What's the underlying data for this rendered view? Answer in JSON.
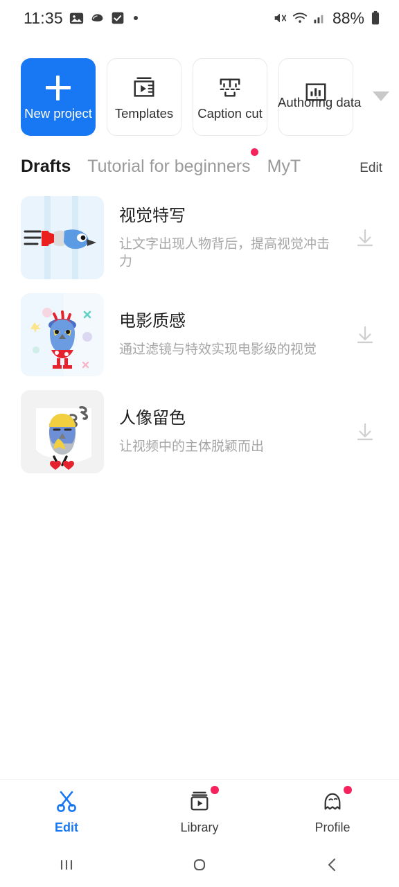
{
  "status_bar": {
    "time": "11:35",
    "battery_percent": "88%",
    "left_icons": [
      "gallery-icon",
      "shell-icon",
      "checkbox-icon",
      "dot-indicator"
    ],
    "right_icons": [
      "mute-icon",
      "wifi-icon",
      "signal-icon",
      "battery-icon"
    ]
  },
  "quick_actions": {
    "items": [
      {
        "label": "New project",
        "icon": "plus-icon",
        "primary": true
      },
      {
        "label": "Templates",
        "icon": "template-video-icon",
        "primary": false
      },
      {
        "label": "Caption cut",
        "icon": "caption-cut-icon",
        "primary": false
      },
      {
        "label": "Authoring data",
        "icon": "bar-chart-icon",
        "primary": false
      }
    ],
    "expand_icon": "chevron-down-icon"
  },
  "tabs": {
    "items": [
      {
        "label": "Drafts",
        "active": true,
        "badge": false
      },
      {
        "label": "Tutorial for beginners",
        "active": false,
        "badge": true
      },
      {
        "label": "MyT",
        "active": false,
        "badge": false
      }
    ],
    "edit_label": "Edit"
  },
  "drafts": {
    "items": [
      {
        "title": "视觉特写",
        "subtitle": "让文字出现人物背后，提高视觉冲击力",
        "thumbnail": "blue-bird-pencil-thumbnail",
        "action_icon": "download-icon"
      },
      {
        "title": "电影质感",
        "subtitle": "通过滤镜与特效实现电影级的视觉",
        "thumbnail": "owl-red-hat-thumbnail",
        "action_icon": "download-icon"
      },
      {
        "title": "人像留色",
        "subtitle": "让视频中的主体脱颖而出",
        "thumbnail": "sleeping-bird-thumbnail",
        "action_icon": "download-icon"
      }
    ]
  },
  "bottom_nav": {
    "items": [
      {
        "label": "Edit",
        "icon": "scissors-icon",
        "active": true,
        "badge": false
      },
      {
        "label": "Library",
        "icon": "library-video-icon",
        "active": false,
        "badge": true
      },
      {
        "label": "Profile",
        "icon": "ghost-icon",
        "active": false,
        "badge": true
      }
    ]
  },
  "system_nav": {
    "recents_icon": "recents-icon",
    "home_icon": "home-icon",
    "back_icon": "back-icon"
  },
  "colors": {
    "accent": "#1877f2",
    "badge": "#f5225c",
    "title": "#1f1f1f",
    "muted": "#a6a6a6"
  }
}
